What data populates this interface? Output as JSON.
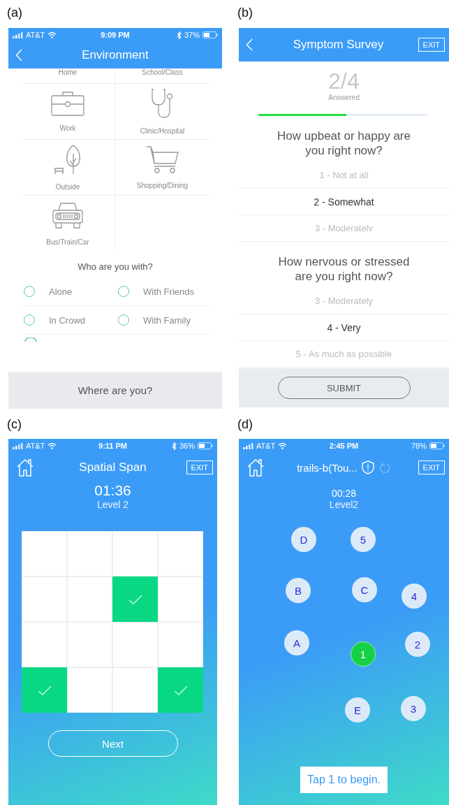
{
  "panel_a": {
    "label": "(a)",
    "status_bar": {
      "carrier": "AT&T",
      "time": "9:09 PM",
      "battery": "37%",
      "bluetooth": true
    },
    "title": "Environment",
    "locations": [
      {
        "label": "Home",
        "kind": "label_only"
      },
      {
        "label": "School/Class",
        "kind": "label_only"
      },
      {
        "label": "Work",
        "kind": "briefcase"
      },
      {
        "label": "Clinic/Hospital",
        "kind": "stethoscope"
      },
      {
        "label": "Outside",
        "kind": "tree"
      },
      {
        "label": "Shopping/Dining",
        "kind": "cart"
      },
      {
        "label": "Bus/Train/Car",
        "kind": "car"
      }
    ],
    "companions_title": "Who are you with?",
    "companions": [
      {
        "label": "Alone",
        "selected": false
      },
      {
        "label": "With Friends",
        "selected": false
      },
      {
        "label": "In Crowd",
        "selected": false
      },
      {
        "label": "With Family",
        "selected": false
      }
    ],
    "bottom_bar": "Where are you?"
  },
  "panel_b": {
    "label": "(b)",
    "title": "Symptom Survey",
    "exit": "EXIT",
    "progress": {
      "count": "2/4",
      "caption": "Answered",
      "level": 0.52
    },
    "questions": [
      {
        "text": "How upbeat or happy are you right now?",
        "options": [
          {
            "label": "1 - Not at all",
            "selected": false
          },
          {
            "label": "2 - Somewhat",
            "selected": true
          },
          {
            "label": "3 - Moderatelv",
            "selected": false
          }
        ]
      },
      {
        "text": "How nervous or stressed are you right now?",
        "options": [
          {
            "label": "3 - Moderately",
            "selected": false
          },
          {
            "label": "4 - Very",
            "selected": true
          },
          {
            "label": "5 - As much as possible",
            "selected": false
          }
        ]
      }
    ],
    "submit": "SUBMIT"
  },
  "panel_c": {
    "label": "(c)",
    "status_bar": {
      "carrier": "AT&T",
      "time": "9:11 PM",
      "battery": "36%",
      "bluetooth": true
    },
    "title": "Spatial Span",
    "exit": "EXIT",
    "timer": "01:36",
    "level_text": "Level 2",
    "grid": [
      {
        "cells": [
          {
            "checked": false
          },
          {
            "checked": false
          },
          {
            "checked": false
          },
          {
            "checked": false
          }
        ]
      },
      {
        "cells": [
          {
            "checked": false
          },
          {
            "checked": false
          },
          {
            "checked": true
          },
          {
            "checked": false
          }
        ]
      },
      {
        "cells": [
          {
            "checked": false
          },
          {
            "checked": false
          },
          {
            "checked": false
          },
          {
            "checked": false
          }
        ]
      },
      {
        "cells": [
          {
            "checked": true
          },
          {
            "checked": false
          },
          {
            "checked": false
          },
          {
            "checked": true
          }
        ]
      }
    ],
    "next": "Next"
  },
  "panel_d": {
    "label": "(d)",
    "status_bar": {
      "carrier": "AT&T",
      "time": "2:45 PM",
      "battery": "78%",
      "bluetooth": false
    },
    "title": "trails-b(Tou...",
    "exit": "EXIT",
    "timer": "00:28",
    "level_text": "Level2",
    "nodes": [
      {
        "label": "D",
        "selected": false
      },
      {
        "label": "5",
        "selected": false
      },
      {
        "label": "B",
        "selected": false
      },
      {
        "label": "C",
        "selected": false
      },
      {
        "label": "4",
        "selected": false
      },
      {
        "label": "A",
        "selected": false
      },
      {
        "label": "1",
        "selected": true
      },
      {
        "label": "2",
        "selected": false
      },
      {
        "label": "E",
        "selected": false
      },
      {
        "label": "3",
        "selected": false
      }
    ],
    "hint": "Tap 1 to begin."
  }
}
